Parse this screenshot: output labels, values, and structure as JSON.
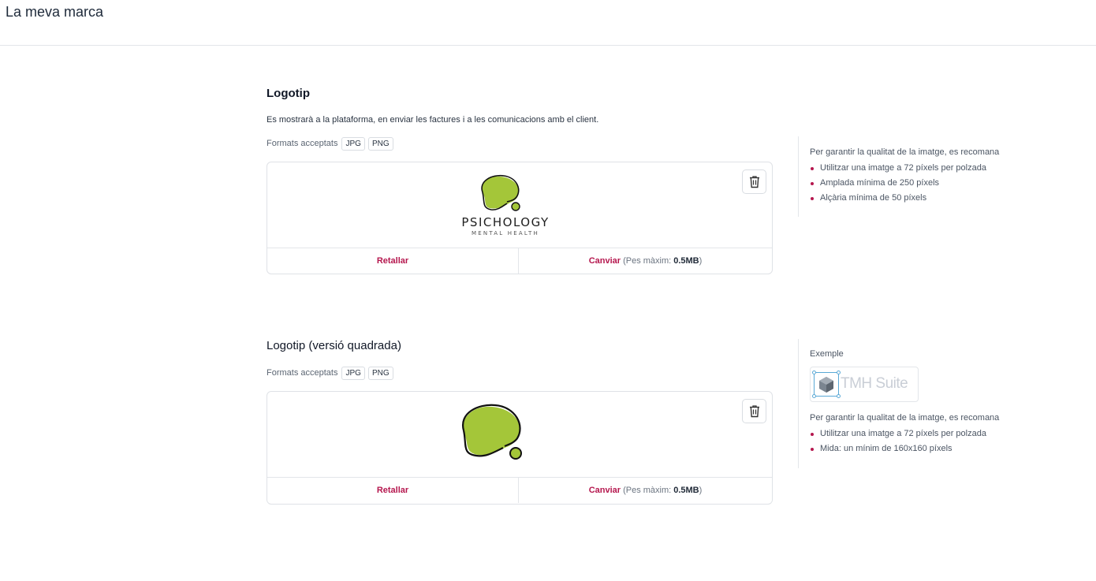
{
  "header": {
    "title": "La meva marca"
  },
  "logo_section": {
    "title": "Logotip",
    "description": "Es mostrarà a la plataforma, en enviar les factures i a les comunicacions amb el client.",
    "formats_label": "Formats acceptats",
    "formats": [
      "JPG",
      "PNG"
    ],
    "logo_text_main": "PSICHOLOGY",
    "logo_text_sub": "MENTAL HEALTH",
    "crop_label": "Retallar",
    "change_label": "Canviar",
    "max_weight_prefix": "(Pes màxim:",
    "max_weight_value": "0.5MB",
    "max_weight_suffix": ")"
  },
  "logo_square_section": {
    "title": "Logotip (versió quadrada)",
    "formats_label": "Formats acceptats",
    "formats": [
      "JPG",
      "PNG"
    ],
    "crop_label": "Retallar",
    "change_label": "Canviar",
    "max_weight_prefix": "(Pes màxim:",
    "max_weight_value": "0.5MB",
    "max_weight_suffix": ")"
  },
  "side_logo": {
    "recommend": "Per garantir la qualitat de la imatge, es recomana",
    "items": [
      "Utilitzar una imatge a 72 píxels per polzada",
      "Amplada mínima de 250 píxels",
      "Alçària mínima de 50 píxels"
    ]
  },
  "side_square": {
    "example_label": "Exemple",
    "example_logo_text": "TMH Suite",
    "recommend": "Per garantir la qualitat de la imatge, es recomana",
    "items": [
      "Utilitzar una imatge a 72 píxels per polzada",
      "Mida: un mínim de 160x160 píxels"
    ]
  },
  "colors": {
    "accent": "#b5174e",
    "logo_green": "#a4c639",
    "border": "#dfe2e6"
  },
  "icons": {
    "trash": "trash-icon",
    "example_cube": "cube-icon"
  }
}
